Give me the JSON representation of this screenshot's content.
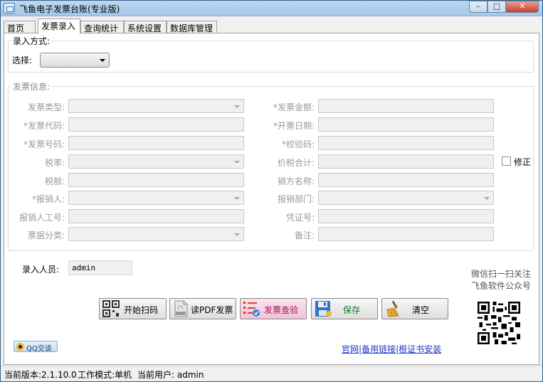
{
  "window": {
    "title": "飞鱼电子发票台账(专业版)",
    "min_glyph": "–",
    "max_glyph": "□",
    "close_glyph": "✕"
  },
  "tabs": [
    {
      "label": "首页",
      "active": false
    },
    {
      "label": "发票录入",
      "active": true
    },
    {
      "label": "查询统计",
      "active": false
    },
    {
      "label": "系统设置",
      "active": false
    },
    {
      "label": "数据库管理",
      "active": false
    }
  ],
  "entry_method": {
    "legend": "录入方式:",
    "select_label": "选择:",
    "select_value": ""
  },
  "invoice": {
    "legend": "发票信息:",
    "left_fields": [
      {
        "label": "发票类型:",
        "type": "combo",
        "value": ""
      },
      {
        "label": "*发票代码:",
        "type": "text",
        "value": ""
      },
      {
        "label": "*发票号码:",
        "type": "text",
        "value": ""
      },
      {
        "label": "税率:",
        "type": "combo",
        "value": ""
      },
      {
        "label": "税额:",
        "type": "text",
        "value": ""
      },
      {
        "label": "*报销人:",
        "type": "combo",
        "value": ""
      },
      {
        "label": "报销人工号:",
        "type": "text",
        "value": ""
      },
      {
        "label": "票据分类:",
        "type": "combo",
        "value": ""
      }
    ],
    "right_fields": [
      {
        "label": "*发票金额:",
        "type": "text",
        "value": ""
      },
      {
        "label": "*开票日期:",
        "type": "text",
        "value": ""
      },
      {
        "label": "*校验码:",
        "type": "text",
        "value": ""
      },
      {
        "label": "价税合计:",
        "type": "text",
        "value": ""
      },
      {
        "label": "销方名称:",
        "type": "text",
        "value": ""
      },
      {
        "label": "报销部门:",
        "type": "combo",
        "value": ""
      },
      {
        "label": "凭证号:",
        "type": "text",
        "value": ""
      },
      {
        "label": "备注:",
        "type": "text",
        "value": ""
      }
    ],
    "modify_checkbox": {
      "label": "修正",
      "checked": false
    }
  },
  "operator": {
    "label": "录入人员:",
    "value": "admin"
  },
  "wechat_note": {
    "line1": "微信扫一扫关注",
    "line2": "飞鱼软件公众号"
  },
  "buttons": {
    "scan": {
      "label": "开始扫码",
      "icon": "qr-code-icon"
    },
    "read_pdf": {
      "label": "读PDF发票",
      "icon": "pdf-icon"
    },
    "verify": {
      "label": "发票查验",
      "icon": "checklist-icon"
    },
    "save": {
      "label": "保存",
      "icon": "floppy-disk-icon"
    },
    "clear": {
      "label": "清空",
      "icon": "broom-icon"
    }
  },
  "qq_button": {
    "label": "QQ交谈",
    "icon": "qq-penguin-icon"
  },
  "links": {
    "official": "官网",
    "backup": "备用链接",
    "cert": "根证书安装",
    "sep": "|"
  },
  "status": {
    "version": "当前版本:2.1.10.0",
    "mode": "工作模式:单机",
    "user": "当前用户:  admin"
  },
  "colors": {
    "titlebar": "#a4c6e8",
    "link": "#1a35c9",
    "verify_button": "#efc3d6",
    "close_button": "#c7402a"
  }
}
